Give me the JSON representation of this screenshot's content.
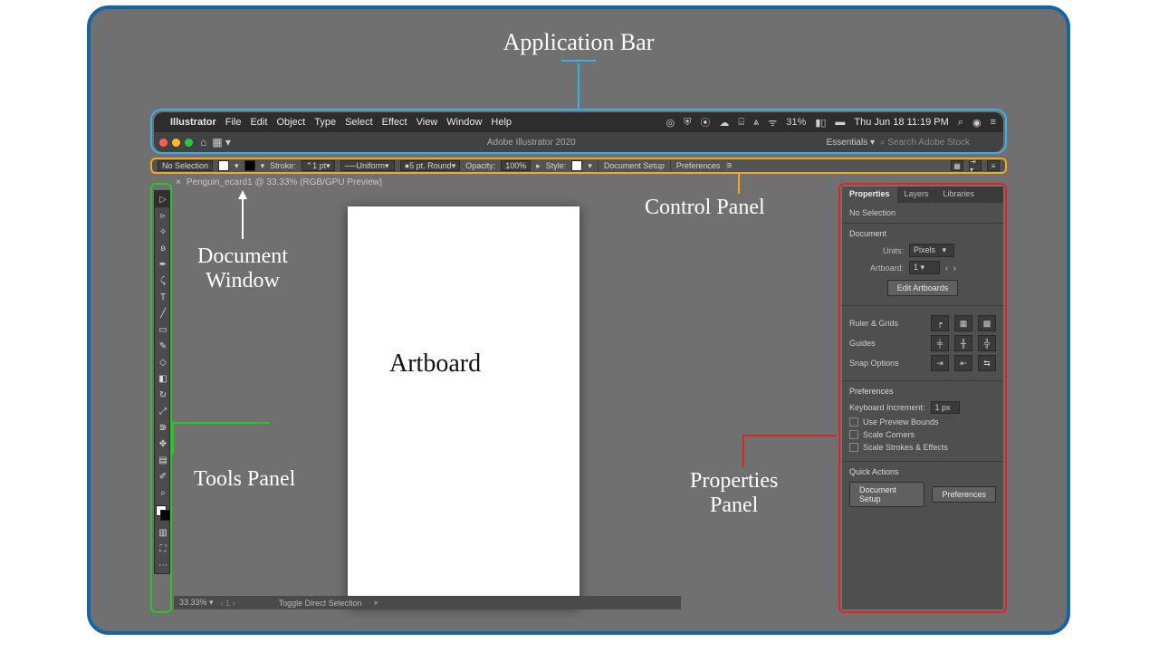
{
  "annotations": {
    "app_bar": "Application Bar",
    "control_panel": "Control Panel",
    "document_window_l1": "Document",
    "document_window_l2": "Window",
    "tools_panel": "Tools Panel",
    "properties_panel_l1": "Properties",
    "properties_panel_l2": "Panel",
    "artboard": "Artboard"
  },
  "menubar": {
    "app": "Illustrator",
    "items": [
      "File",
      "Edit",
      "Object",
      "Type",
      "Select",
      "Effect",
      "View",
      "Window",
      "Help"
    ],
    "battery": "31%",
    "datetime": "Thu Jun 18  11:19 PM",
    "row2_title": "Adobe Illustrator 2020",
    "workspace": "Essentials",
    "stock_placeholder": "Search Adobe Stock"
  },
  "control": {
    "selection": "No Selection",
    "stroke_label": "Stroke:",
    "stroke_val": "1 pt",
    "stroke_style": "Uniform",
    "brush": "5 pt. Round",
    "opacity_label": "Opacity:",
    "opacity_val": "100%",
    "style_label": "Style:",
    "doc_setup": "Document Setup",
    "prefs": "Preferences"
  },
  "doctab": {
    "name": "Penguin_ecard1 @ 33.33% (RGB/GPU Preview)"
  },
  "props": {
    "tabs": [
      "Properties",
      "Layers",
      "Libraries"
    ],
    "nosel": "No Selection",
    "document": "Document",
    "units_label": "Units:",
    "units_val": "Pixels",
    "artboard_label": "Artboard:",
    "artboard_val": "1",
    "edit_artboards": "Edit Artboards",
    "ruler_grids": "Ruler & Grids",
    "guides": "Guides",
    "snap": "Snap Options",
    "preferences": "Preferences",
    "kb_inc_label": "Keyboard Increment:",
    "kb_inc_val": "1 px",
    "chk1": "Use Preview Bounds",
    "chk2": "Scale Corners",
    "chk3": "Scale Strokes & Effects",
    "quick_actions": "Quick Actions",
    "qa1": "Document Setup",
    "qa2": "Preferences"
  },
  "status": {
    "zoom": "33.33%",
    "msg": "Toggle Direct Selection"
  }
}
